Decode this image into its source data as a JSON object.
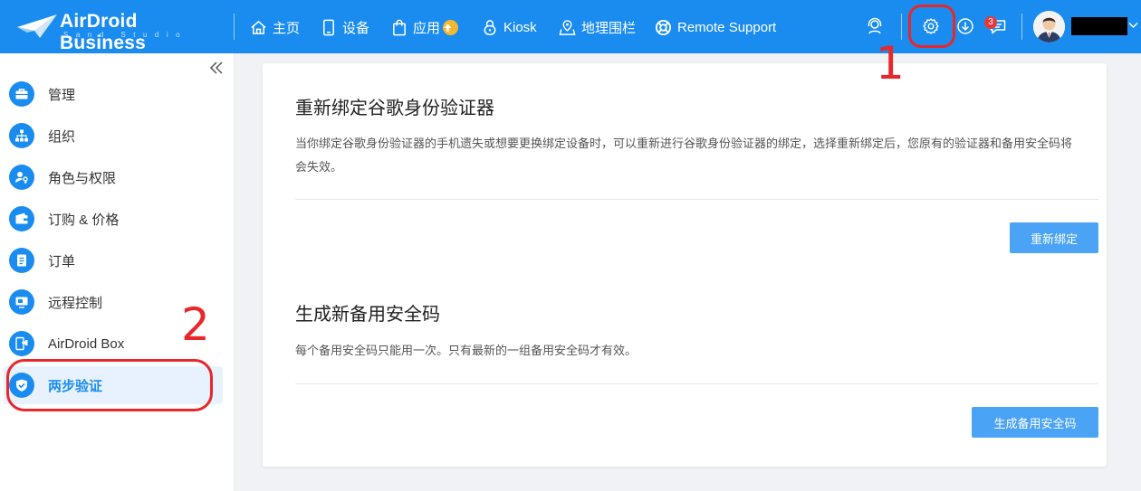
{
  "brand": {
    "name": "AirDroid Business",
    "sub": "Sand Studio"
  },
  "nav": [
    {
      "label": "主页"
    },
    {
      "label": "设备"
    },
    {
      "label": "应用"
    },
    {
      "label": "Kiosk"
    },
    {
      "label": "地理围栏"
    },
    {
      "label": "Remote Support"
    }
  ],
  "header": {
    "notification_count": "3"
  },
  "sidebar": {
    "items": [
      {
        "label": "管理"
      },
      {
        "label": "组织"
      },
      {
        "label": "角色与权限"
      },
      {
        "label": "订购 & 价格"
      },
      {
        "label": "订单"
      },
      {
        "label": "远程控制"
      },
      {
        "label": "AirDroid Box"
      },
      {
        "label": "两步验证"
      }
    ]
  },
  "main": {
    "rebind": {
      "title": "重新绑定谷歌身份验证器",
      "desc": "当你绑定谷歌身份验证器的手机遗失或想要更换绑定设备时，可以重新进行谷歌身份验证器的绑定，选择重新绑定后，您原有的验证器和备用安全码将会失效。",
      "button": "重新绑定"
    },
    "backup": {
      "title": "生成新备用安全码",
      "desc": "每个备用安全码只能用一次。只有最新的一组备用安全码才有效。",
      "button": "生成备用安全码"
    }
  },
  "annotations": {
    "one": "1",
    "two": "2"
  },
  "colors": {
    "primary": "#1a8cf0",
    "button": "#4aa3f5",
    "annotation": "#e8272b"
  }
}
